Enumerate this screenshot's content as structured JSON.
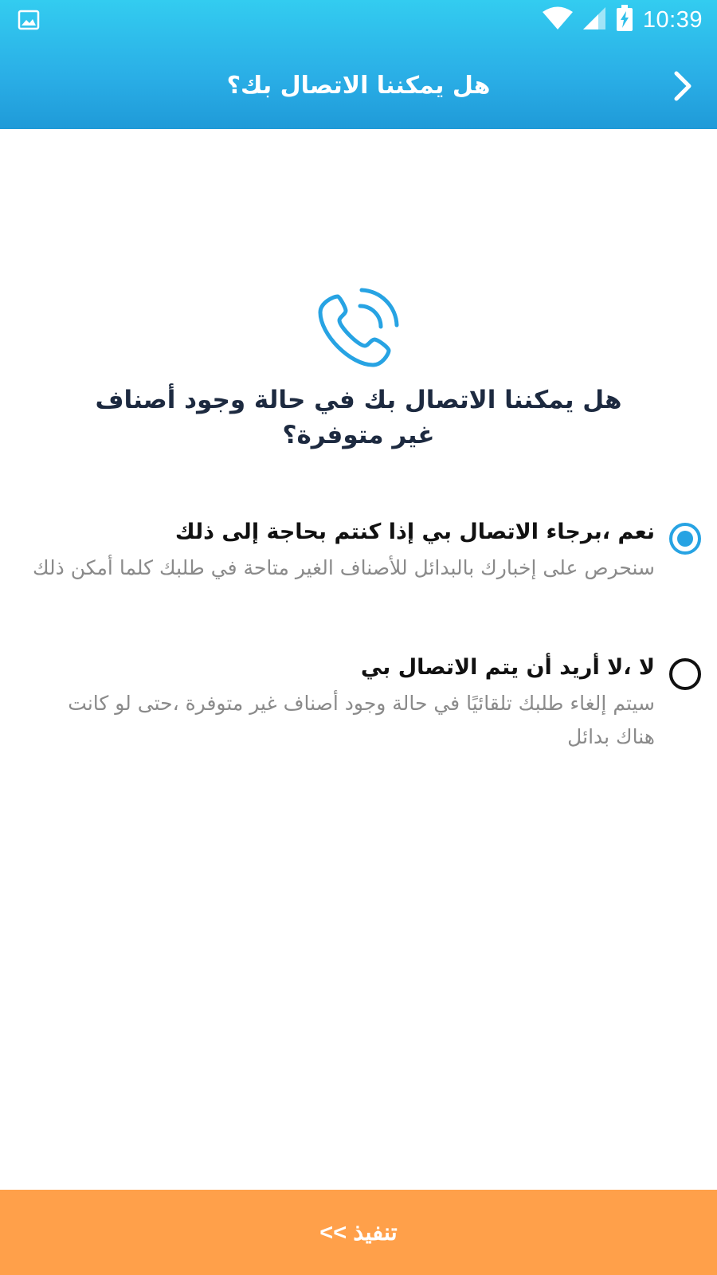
{
  "status_bar": {
    "time": "10:39",
    "icons": [
      "gallery-icon",
      "wifi-icon",
      "cell-signal-icon",
      "battery-charging-icon"
    ]
  },
  "toolbar": {
    "title": "هل يمكننا الاتصال بك؟",
    "back_icon": "chevron-right-icon"
  },
  "main": {
    "icon": "phone-ringing-icon",
    "question": "هل يمكننا الاتصال بك في حالة وجود أصناف غير متوفرة؟",
    "options": [
      {
        "label": "نعم ،برجاء الاتصال بي إذا كنتم بحاجة إلى ذلك",
        "description": "سنحرص على إخبارك بالبدائل للأصناف الغير متاحة في طلبك كلما أمكن ذلك",
        "selected": true
      },
      {
        "label": "لا ،لا أريد أن يتم الاتصال بي",
        "description": "سيتم إلغاء طلبك تلقائيًا في حالة وجود أصناف غير متوفرة ،حتى لو كانت هناك بدائل",
        "selected": false
      }
    ]
  },
  "footer": {
    "submit_label": "تنفيذ >>"
  },
  "colors": {
    "header_top": "#33ccf0",
    "header_bottom": "#1f9ad8",
    "accent": "#27a3e3",
    "submit_bg": "#ffa04a",
    "title_text": "#1d2a40",
    "desc_text": "#8a8a8a"
  }
}
